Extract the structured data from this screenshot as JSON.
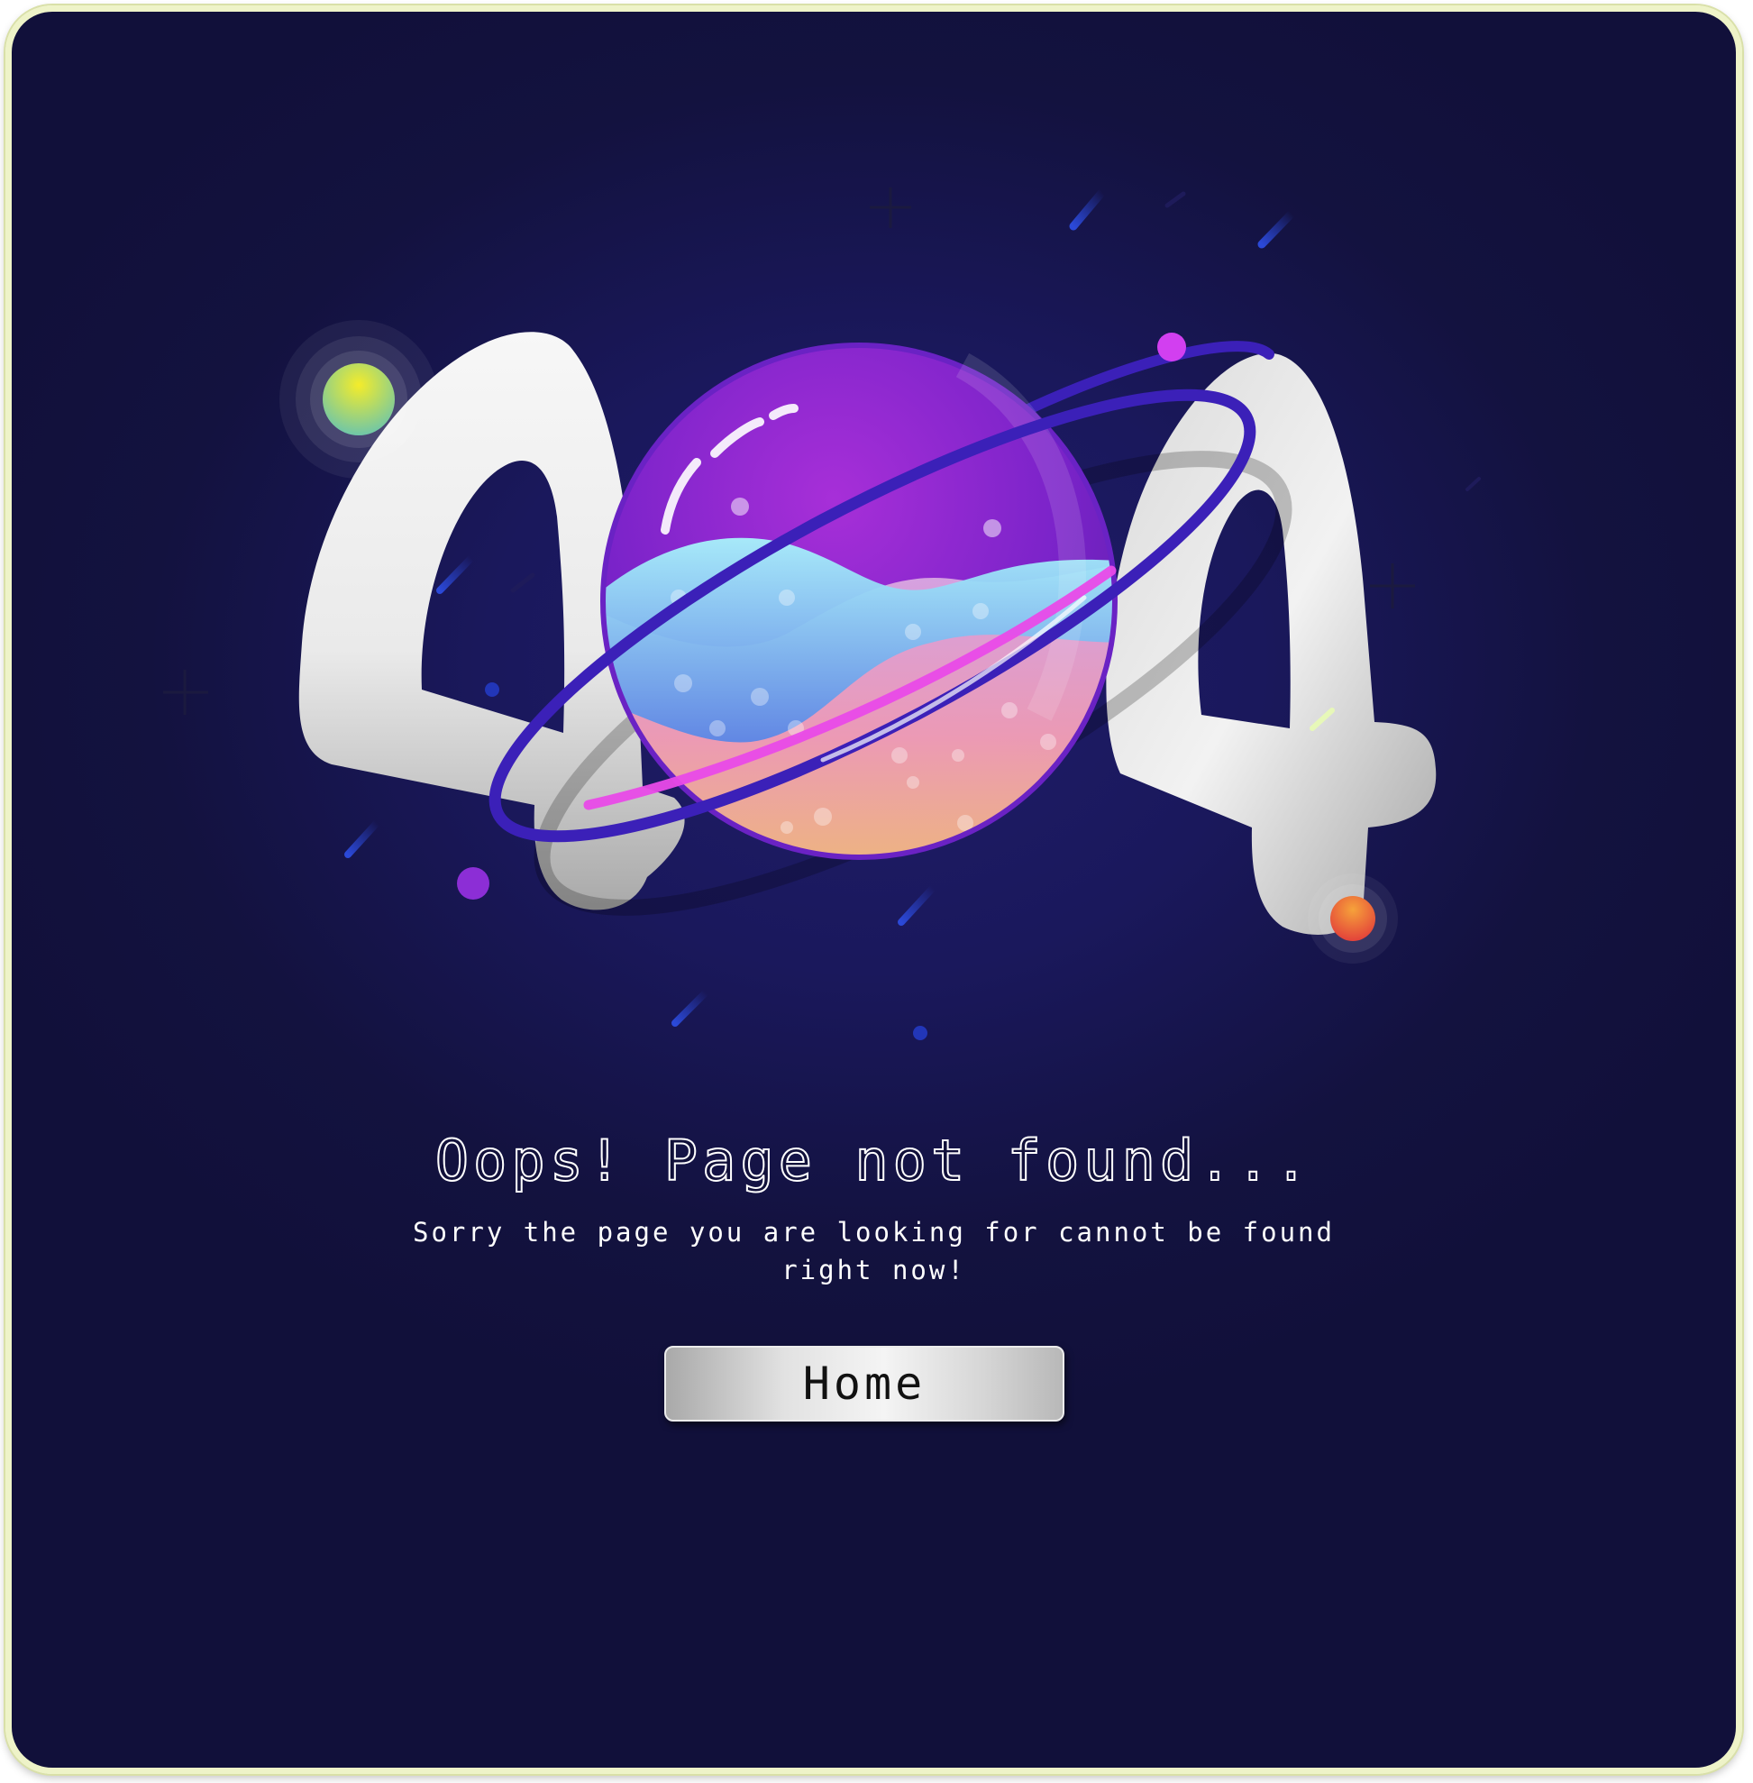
{
  "page": {
    "heading": "Oops! Page not found...",
    "message": "Sorry the page you are looking for cannot be found right now!",
    "home_button": "Home"
  },
  "illustration": {
    "figure_left_digit": "4",
    "figure_right_digit": "4",
    "figure_center": "planet-icon",
    "colors": {
      "background": "#11103a",
      "digits": "#ffffff",
      "planet": "#8e2bd6",
      "liquid_top": "#7fd3f6",
      "liquid_bottom": "#f2a7a0",
      "ring": "#3b20b8",
      "left_moon": "#d6e83a",
      "right_moon": "#f05a3a"
    }
  }
}
